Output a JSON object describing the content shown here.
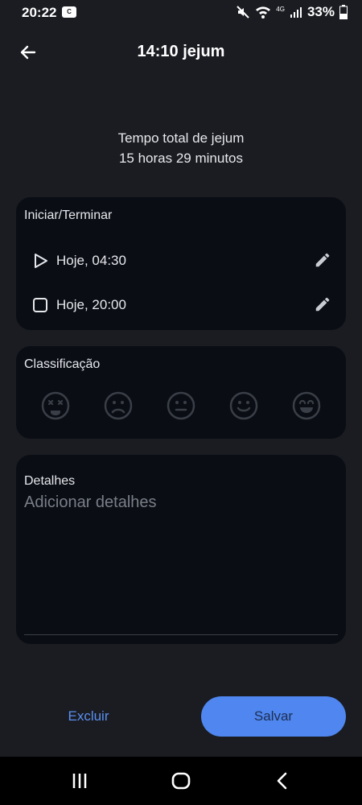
{
  "status_bar": {
    "time": "20:22",
    "notif_icon_text": "Cₒ",
    "network_label": "4G",
    "battery": "33%"
  },
  "header": {
    "title": "14:10 jejum",
    "back_icon": "arrow-left-icon"
  },
  "total": {
    "label": "Tempo total de jejum",
    "value": "15 horas 29 minutos"
  },
  "start_end": {
    "title": "Iniciar/Terminar",
    "start": {
      "icon": "play-icon",
      "text": "Hoje, 04:30",
      "edit_icon": "pencil-icon"
    },
    "end": {
      "icon": "stop-square-icon",
      "text": "Hoje, 20:00",
      "edit_icon": "pencil-icon"
    }
  },
  "rating": {
    "title": "Classificação",
    "faces": [
      "dead-face-icon",
      "sad-face-icon",
      "neutral-face-icon",
      "smile-face-icon",
      "grin-face-icon"
    ],
    "selected": null
  },
  "details": {
    "title": "Detalhes",
    "placeholder": "Adicionar detalhes",
    "value": ""
  },
  "actions": {
    "delete_label": "Excluir",
    "save_label": "Salvar"
  },
  "colors": {
    "background": "#1a1c21",
    "card": "#0a0d14",
    "accent": "#4f86ef",
    "link": "#5b8ff0"
  }
}
